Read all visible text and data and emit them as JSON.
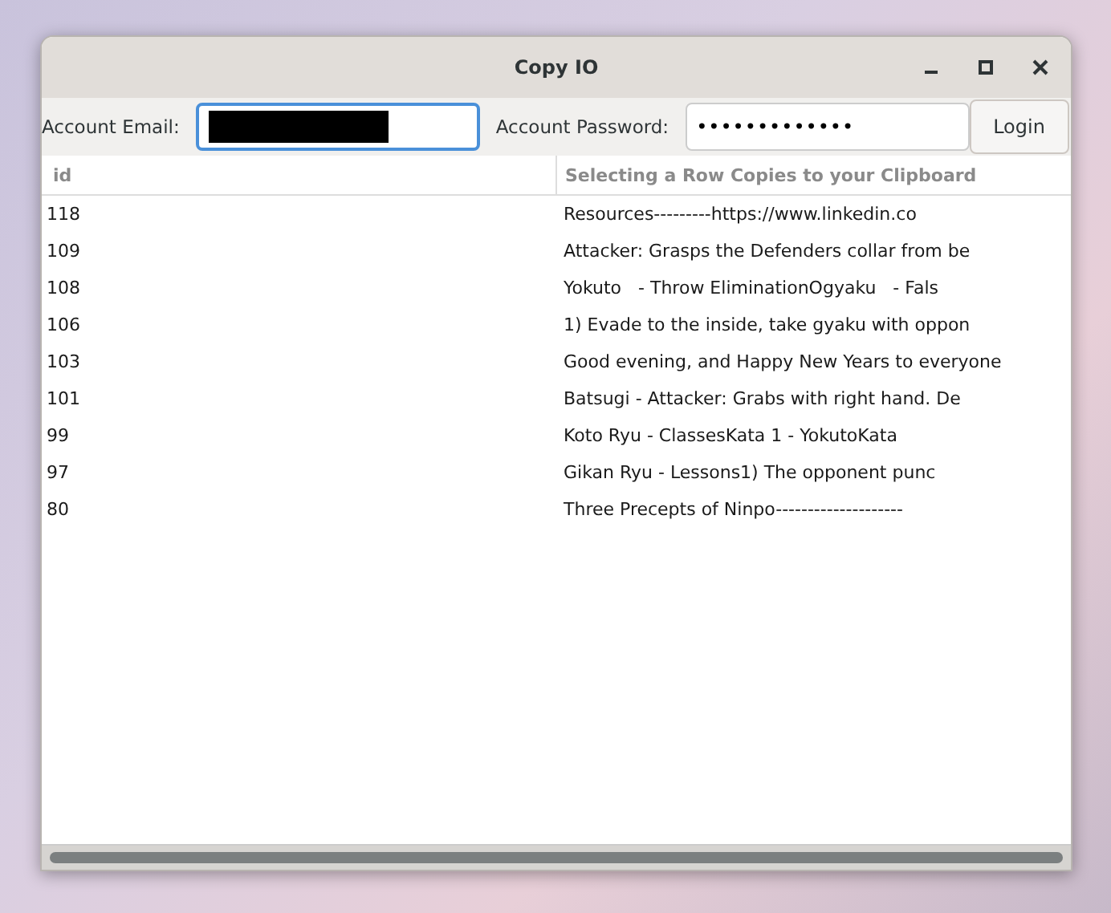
{
  "window": {
    "title": "Copy IO"
  },
  "form": {
    "email_label": "Account Email:",
    "password_label": "Account Password:",
    "password_value": "•••••••••••••",
    "login_button": "Login"
  },
  "table": {
    "columns": [
      "id",
      "Selecting a Row Copies to your Clipboard"
    ],
    "rows": [
      [
        "118",
        "Resources---------https://www.linkedin.co"
      ],
      [
        "109",
        "Attacker: Grasps the Defenders collar from be"
      ],
      [
        "108",
        "Yokuto   - Throw EliminationOgyaku   - Fals"
      ],
      [
        "106",
        "1) Evade to the inside, take gyaku with oppon"
      ],
      [
        "103",
        "Good evening, and Happy New Years to everyone"
      ],
      [
        "101",
        "Batsugi - Attacker: Grabs with right hand. De"
      ],
      [
        "99",
        "Koto Ryu - ClassesKata 1 - YokutoKata"
      ],
      [
        "97",
        "Gikan Ryu - Lessons1) The opponent punc"
      ],
      [
        "80",
        "Three Precepts of Ninpo--------------------"
      ]
    ]
  }
}
